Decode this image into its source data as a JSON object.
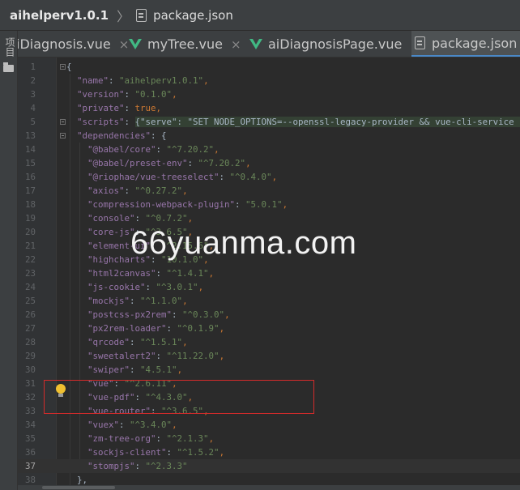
{
  "breadcrumb": {
    "project": "aihelperv1.0.1",
    "separator": "〉",
    "file": "package.json"
  },
  "sidebar": {
    "project_label": "项目"
  },
  "tabs": [
    {
      "label": "iDiagnosis.vue",
      "icon": "none",
      "active": false
    },
    {
      "label": "myTree.vue",
      "icon": "vue-icon",
      "active": false
    },
    {
      "label": "aiDiagnosisPage.vue",
      "icon": "vue-icon",
      "active": false
    },
    {
      "label": "package.json",
      "icon": "json-file-icon",
      "active": true
    }
  ],
  "tab_close_glyph": "×",
  "editor": {
    "current_line": "37",
    "lines": [
      {
        "n": "1",
        "parts": [
          [
            "p",
            "{"
          ]
        ]
      },
      {
        "n": "2",
        "parts": [
          [
            "p",
            "  "
          ],
          [
            "k",
            "\"name\""
          ],
          [
            "p",
            ": "
          ],
          [
            "s",
            "\"aihelperv1.0.1\""
          ],
          [
            "b",
            ","
          ]
        ]
      },
      {
        "n": "3",
        "parts": [
          [
            "p",
            "  "
          ],
          [
            "k",
            "\"version\""
          ],
          [
            "p",
            ": "
          ],
          [
            "s",
            "\"0.1.0\""
          ],
          [
            "b",
            ","
          ]
        ]
      },
      {
        "n": "4",
        "parts": [
          [
            "p",
            "  "
          ],
          [
            "k",
            "\"private\""
          ],
          [
            "p",
            ": "
          ],
          [
            "b",
            "true,"
          ]
        ]
      },
      {
        "n": "5",
        "parts": [
          [
            "p",
            "  "
          ],
          [
            "k",
            "\"scripts\""
          ],
          [
            "p",
            ": "
          ],
          [
            "hl",
            "{\"serve\": \"SET NODE_OPTIONS=--openssl-legacy-provider && vue-cli-service serve -"
          ]
        ]
      },
      {
        "n": "13",
        "parts": [
          [
            "p",
            "  "
          ],
          [
            "k",
            "\"dependencies\""
          ],
          [
            "p",
            ": {"
          ]
        ]
      },
      {
        "n": "14",
        "parts": [
          [
            "p",
            "    "
          ],
          [
            "k",
            "\"@babel/core\""
          ],
          [
            "p",
            ": "
          ],
          [
            "s",
            "\"^7.20.2\""
          ],
          [
            "b",
            ","
          ]
        ]
      },
      {
        "n": "15",
        "parts": [
          [
            "p",
            "    "
          ],
          [
            "k",
            "\"@babel/preset-env\""
          ],
          [
            "p",
            ": "
          ],
          [
            "s",
            "\"^7.20.2\""
          ],
          [
            "b",
            ","
          ]
        ]
      },
      {
        "n": "16",
        "parts": [
          [
            "p",
            "    "
          ],
          [
            "k",
            "\"@riophae/vue-treeselect\""
          ],
          [
            "p",
            ": "
          ],
          [
            "s",
            "\"^0.4.0\""
          ],
          [
            "b",
            ","
          ]
        ]
      },
      {
        "n": "17",
        "parts": [
          [
            "p",
            "    "
          ],
          [
            "k",
            "\"axios\""
          ],
          [
            "p",
            ": "
          ],
          [
            "s",
            "\"^0.27.2\""
          ],
          [
            "b",
            ","
          ]
        ]
      },
      {
        "n": "18",
        "parts": [
          [
            "p",
            "    "
          ],
          [
            "k",
            "\"compression-webpack-plugin\""
          ],
          [
            "p",
            ": "
          ],
          [
            "s",
            "\"5.0.1\""
          ],
          [
            "b",
            ","
          ]
        ]
      },
      {
        "n": "19",
        "parts": [
          [
            "p",
            "    "
          ],
          [
            "k",
            "\"console\""
          ],
          [
            "p",
            ": "
          ],
          [
            "s",
            "\"^0.7.2\""
          ],
          [
            "b",
            ","
          ]
        ]
      },
      {
        "n": "20",
        "parts": [
          [
            "p",
            "    "
          ],
          [
            "k",
            "\"core-js\""
          ],
          [
            "p",
            ": "
          ],
          [
            "s",
            "\"^3.6.5\""
          ],
          [
            "b",
            ","
          ]
        ]
      },
      {
        "n": "21",
        "parts": [
          [
            "p",
            "    "
          ],
          [
            "k",
            "\"element-ui\""
          ],
          [
            "p",
            ": "
          ],
          [
            "s",
            "\"^2.15.6\""
          ],
          [
            "b",
            ","
          ]
        ]
      },
      {
        "n": "22",
        "parts": [
          [
            "p",
            "    "
          ],
          [
            "k",
            "\"highcharts\""
          ],
          [
            "p",
            ": "
          ],
          [
            "s",
            "\"10.1.0\""
          ],
          [
            "b",
            ","
          ]
        ]
      },
      {
        "n": "23",
        "parts": [
          [
            "p",
            "    "
          ],
          [
            "k",
            "\"html2canvas\""
          ],
          [
            "p",
            ": "
          ],
          [
            "s",
            "\"^1.4.1\""
          ],
          [
            "b",
            ","
          ]
        ]
      },
      {
        "n": "24",
        "parts": [
          [
            "p",
            "    "
          ],
          [
            "k",
            "\"js-cookie\""
          ],
          [
            "p",
            ": "
          ],
          [
            "s",
            "\"^3.0.1\""
          ],
          [
            "b",
            ","
          ]
        ]
      },
      {
        "n": "25",
        "parts": [
          [
            "p",
            "    "
          ],
          [
            "k",
            "\"mockjs\""
          ],
          [
            "p",
            ": "
          ],
          [
            "s",
            "\"^1.1.0\""
          ],
          [
            "b",
            ","
          ]
        ]
      },
      {
        "n": "26",
        "parts": [
          [
            "p",
            "    "
          ],
          [
            "k",
            "\"postcss-px2rem\""
          ],
          [
            "p",
            ": "
          ],
          [
            "s",
            "\"^0.3.0\""
          ],
          [
            "b",
            ","
          ]
        ]
      },
      {
        "n": "27",
        "parts": [
          [
            "p",
            "    "
          ],
          [
            "k",
            "\"px2rem-loader\""
          ],
          [
            "p",
            ": "
          ],
          [
            "s",
            "\"^0.1.9\""
          ],
          [
            "b",
            ","
          ]
        ]
      },
      {
        "n": "28",
        "parts": [
          [
            "p",
            "    "
          ],
          [
            "k",
            "\"qrcode\""
          ],
          [
            "p",
            ": "
          ],
          [
            "s",
            "\"^1.5.1\""
          ],
          [
            "b",
            ","
          ]
        ]
      },
      {
        "n": "29",
        "parts": [
          [
            "p",
            "    "
          ],
          [
            "k",
            "\"sweetalert2\""
          ],
          [
            "p",
            ": "
          ],
          [
            "s",
            "\"^11.22.0\""
          ],
          [
            "b",
            ","
          ]
        ]
      },
      {
        "n": "30",
        "parts": [
          [
            "p",
            "    "
          ],
          [
            "k",
            "\"swiper\""
          ],
          [
            "p",
            ": "
          ],
          [
            "s",
            "\"4.5.1\""
          ],
          [
            "b",
            ","
          ]
        ]
      },
      {
        "n": "31",
        "parts": [
          [
            "p",
            "    "
          ],
          [
            "k",
            "\"vue\""
          ],
          [
            "p",
            ": "
          ],
          [
            "s",
            "\"^2.6.11\""
          ],
          [
            "b",
            ","
          ]
        ]
      },
      {
        "n": "32",
        "parts": [
          [
            "p",
            "    "
          ],
          [
            "k",
            "\"vue-pdf\""
          ],
          [
            "p",
            ": "
          ],
          [
            "s",
            "\"^4.3.0\""
          ],
          [
            "b",
            ","
          ]
        ]
      },
      {
        "n": "33",
        "parts": [
          [
            "p",
            "    "
          ],
          [
            "k",
            "\"vue-router\""
          ],
          [
            "p",
            ": "
          ],
          [
            "s",
            "\"^3.6.5\""
          ],
          [
            "b",
            ","
          ]
        ]
      },
      {
        "n": "34",
        "parts": [
          [
            "p",
            "    "
          ],
          [
            "k",
            "\"vuex\""
          ],
          [
            "p",
            ": "
          ],
          [
            "s",
            "\"^3.4.0\""
          ],
          [
            "b",
            ","
          ]
        ]
      },
      {
        "n": "35",
        "parts": [
          [
            "p",
            "    "
          ],
          [
            "k",
            "\"zm-tree-org\""
          ],
          [
            "p",
            ": "
          ],
          [
            "s",
            "\"^2.1.3\""
          ],
          [
            "b",
            ","
          ]
        ]
      },
      {
        "n": "36",
        "parts": [
          [
            "p",
            "    "
          ],
          [
            "k",
            "\"sockjs-client\""
          ],
          [
            "p",
            ": "
          ],
          [
            "s",
            "\"^1.5.2\""
          ],
          [
            "b",
            ","
          ]
        ]
      },
      {
        "n": "37",
        "parts": [
          [
            "p",
            "    "
          ],
          [
            "k",
            "\"stompjs\""
          ],
          [
            "p",
            ": "
          ],
          [
            "s",
            "\"^2.3.3\""
          ]
        ]
      },
      {
        "n": "38",
        "parts": [
          [
            "p",
            "  },"
          ]
        ]
      }
    ]
  },
  "watermark": "66yuanma.com",
  "colors": {
    "key": "#9876aa",
    "string": "#6a8759",
    "keyword": "#cc7832",
    "plain": "#a9b7c6",
    "highlight_box": "#d42b2b",
    "accent": "#4a88c7"
  }
}
